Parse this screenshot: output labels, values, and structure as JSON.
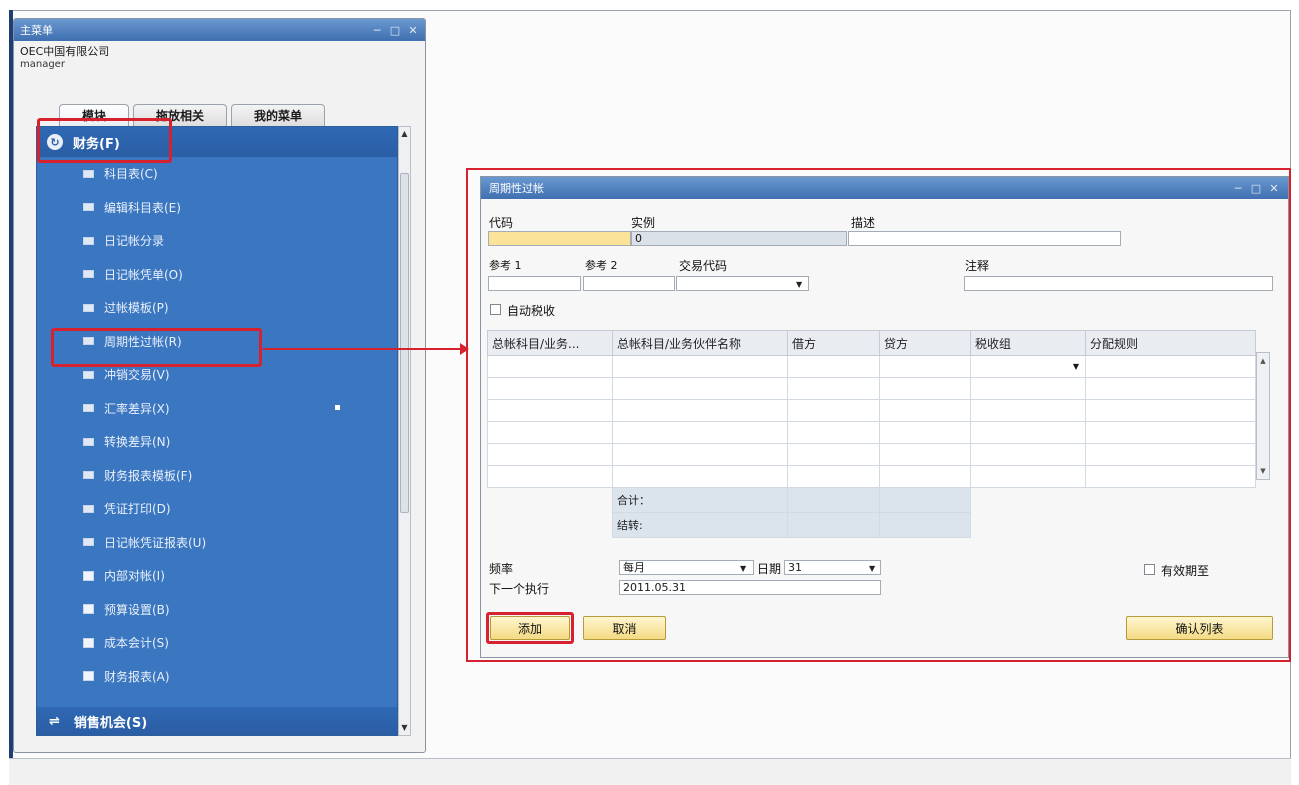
{
  "main_menu": {
    "title": "主菜单",
    "company": "OEC中国有限公司",
    "user": "manager",
    "tabs": [
      "模块",
      "拖放相关",
      "我的菜单"
    ],
    "section": "财务(F)",
    "items": [
      "科目表(C)",
      "编辑科目表(E)",
      "日记帐分录",
      "日记帐凭单(O)",
      "过帐模板(P)",
      "周期性过帐(R)",
      "冲销交易(V)",
      "汇率差异(X)",
      "转换差异(N)",
      "财务报表模板(F)",
      "凭证打印(D)",
      "日记帐凭证报表(U)",
      "内部对帐(I)",
      "预算设置(B)",
      "成本会计(S)",
      "财务报表(A)"
    ],
    "footer_section": "销售机会(S)"
  },
  "dialog": {
    "title": "周期性过帐",
    "labels": {
      "code": "代码",
      "instance": "实例",
      "description": "描述",
      "ref1": "参考 1",
      "ref2": "参考 2",
      "trans_code": "交易代码",
      "remarks": "注释",
      "auto_tax": "自动税收",
      "total": "合计：",
      "carry": "结转:",
      "frequency": "频率",
      "next_exec": "下一个执行",
      "date": "日期",
      "valid_until": "有效期至"
    },
    "values": {
      "instance": "0",
      "frequency": "每月",
      "date": "31",
      "next_exec": "2011.05.31"
    },
    "grid_headers": [
      "总帐科目/业务...",
      "总帐科目/业务伙伴名称",
      "借方",
      "贷方",
      "税收组",
      "分配规则"
    ],
    "buttons": {
      "add": "添加",
      "cancel": "取消",
      "confirm_list": "确认列表"
    }
  },
  "colors": {
    "menu_blue": "#3b76c0",
    "highlight_red": "#d6212f",
    "button_yellow": "#f3da83"
  }
}
